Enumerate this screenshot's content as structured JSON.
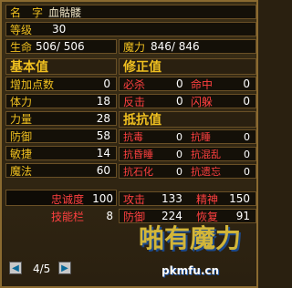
{
  "title": {
    "label": "名　字",
    "name": "血骷髅"
  },
  "level": {
    "label": "等级",
    "value": "30"
  },
  "hp": {
    "label": "生命",
    "value": "506/ 506"
  },
  "mp": {
    "label": "魔力",
    "value": "846/ 846"
  },
  "basic": {
    "header": "基本值",
    "rows": [
      {
        "label": "增加点数",
        "value": "0"
      },
      {
        "label": "体力",
        "value": "18"
      },
      {
        "label": "力量",
        "value": "28"
      },
      {
        "label": "防御",
        "value": "58"
      },
      {
        "label": "敏捷",
        "value": "14"
      },
      {
        "label": "魔法",
        "value": "60"
      }
    ]
  },
  "correction": {
    "header": "修正值",
    "rows": [
      {
        "label1": "必杀",
        "value1": "0",
        "label2": "命中",
        "value2": "0"
      },
      {
        "label1": "反击",
        "value1": "0",
        "label2": "闪躲",
        "value2": "0"
      }
    ]
  },
  "resist": {
    "header": "抵抗值",
    "rows": [
      {
        "label1": "抗毒",
        "value1": "0",
        "label2": "抗睡",
        "value2": "0"
      },
      {
        "label1": "抗昏睡",
        "value1": "0",
        "label2": "抗混乱",
        "value2": "0"
      },
      {
        "label1": "抗石化",
        "value1": "0",
        "label2": "抗遗忘",
        "value2": "0"
      }
    ]
  },
  "bottom": {
    "loyalty_label": "忠诚度",
    "loyalty_value": "100",
    "skill_label": "技能栏",
    "skill_value": "8",
    "attack_label": "攻击",
    "attack_value": "133",
    "agility_label": "精神",
    "agility_value": "150",
    "defense_label": "防御",
    "defense_value": "224",
    "recover_label": "恢复",
    "recover_value": "91"
  },
  "pager": {
    "text": "4/5"
  },
  "watermark": {
    "main": "啪有魔力",
    "sub": "pkmfu.cn"
  }
}
